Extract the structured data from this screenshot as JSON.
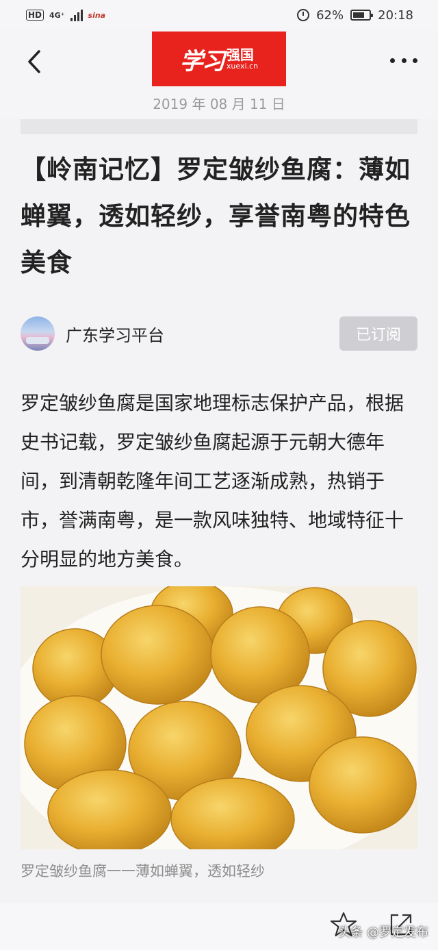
{
  "status_bar": {
    "hd": "HD",
    "network": "4G⁺",
    "battery_percent": "62%",
    "time": "20:18",
    "colors": {
      "text": "#333333"
    }
  },
  "header": {
    "logo_script": "学习",
    "logo_qg": "强国",
    "logo_url": "xuexi.cn",
    "date": "2019 年 08 月 11 日",
    "colors": {
      "logo_bg": "#e8221c"
    }
  },
  "article": {
    "title": "【岭南记忆】罗定皱纱鱼腐：薄如蝉翼，透如轻纱，享誉南粤的特色美食",
    "author": "广东学习平台",
    "subscribe_label": "已订阅",
    "body": "罗定皱纱鱼腐是国家地理标志保护产品，根据史书记载，罗定皱纱鱼腐起源于元朝大德年间，到清朝乾隆年间工艺逐渐成熟，热销于市，誉满南粤，是一款风味独特、地域特征十分明显的地方美食。",
    "caption": "罗定皱纱鱼腐一一薄如蝉翼，透如轻纱"
  },
  "bottom_bar": {
    "icons": [
      "star-icon",
      "share-icon"
    ],
    "watermark": "头条 @罗定发布"
  }
}
